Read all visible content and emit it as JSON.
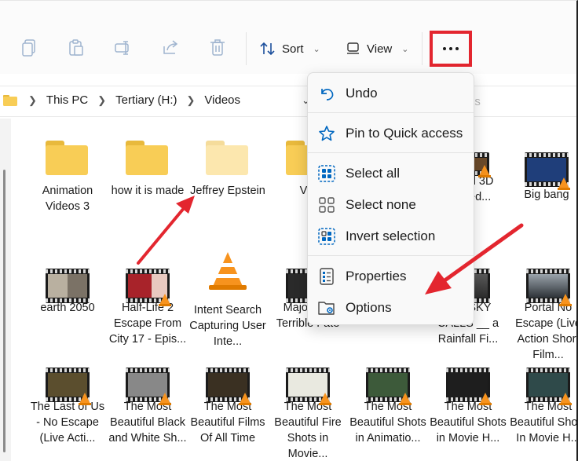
{
  "toolbar": {
    "sort_label": "Sort",
    "view_label": "View",
    "more_icon": "more-dots-icon"
  },
  "breadcrumb": [
    "This PC",
    "Tertiary (H:)",
    "Videos"
  ],
  "address_ghost": "os",
  "context_menu": {
    "items": [
      {
        "label": "Undo",
        "icon": "undo-icon"
      },
      {
        "label": "Pin to Quick access",
        "icon": "star-icon"
      },
      {
        "label": "Select all",
        "icon": "select-all-icon"
      },
      {
        "label": "Select none",
        "icon": "select-none-icon"
      },
      {
        "label": "Invert selection",
        "icon": "invert-selection-icon"
      },
      {
        "label": "Properties",
        "icon": "properties-icon"
      },
      {
        "label": "Options",
        "icon": "options-icon"
      }
    ]
  },
  "files": {
    "row1": [
      {
        "name": "Animation Videos 3",
        "kind": "folder"
      },
      {
        "name": "how it is made",
        "kind": "folder"
      },
      {
        "name": "Jeffrey Epstein",
        "kind": "folder"
      },
      {
        "name": "Vid",
        "kind": "folder"
      },
      {
        "name": "rd 3D ted...",
        "kind": "video"
      },
      {
        "name": "Big bang",
        "kind": "video"
      }
    ],
    "row2": [
      {
        "name": "earth 2050",
        "kind": "video"
      },
      {
        "name": "Half-Life 2 Escape From City 17 - Epis...",
        "kind": "video"
      },
      {
        "name": "Intent Search Capturing User Inte...",
        "kind": "vlc"
      },
      {
        "name": "Majo Mas Terrible Fate",
        "kind": "video"
      },
      {
        "name": "OID SKY CALLS __ a Rainfall Fi...",
        "kind": "video"
      },
      {
        "name": "Portal No Escape (Live Action Short Film...",
        "kind": "video"
      }
    ],
    "row3": [
      {
        "name": "The Last of Us - No Escape (Live Acti...",
        "kind": "video"
      },
      {
        "name": "The Most Beautiful Black and White Sh...",
        "kind": "video"
      },
      {
        "name": "The Most Beautiful Films Of All Time",
        "kind": "video"
      },
      {
        "name": "The Most Beautiful Fire Shots in Movie...",
        "kind": "video"
      },
      {
        "name": "The Most Beautiful Shots in Animatio...",
        "kind": "video"
      },
      {
        "name": "The Most Beautiful Shots in Movie H...",
        "kind": "video"
      },
      {
        "name": "The Most Beautiful Shots In Movie H...",
        "kind": "video"
      }
    ]
  },
  "colors": {
    "highlight": "#e3262f",
    "folder": "#f8cd56",
    "accent_icon": "#0067c0"
  }
}
